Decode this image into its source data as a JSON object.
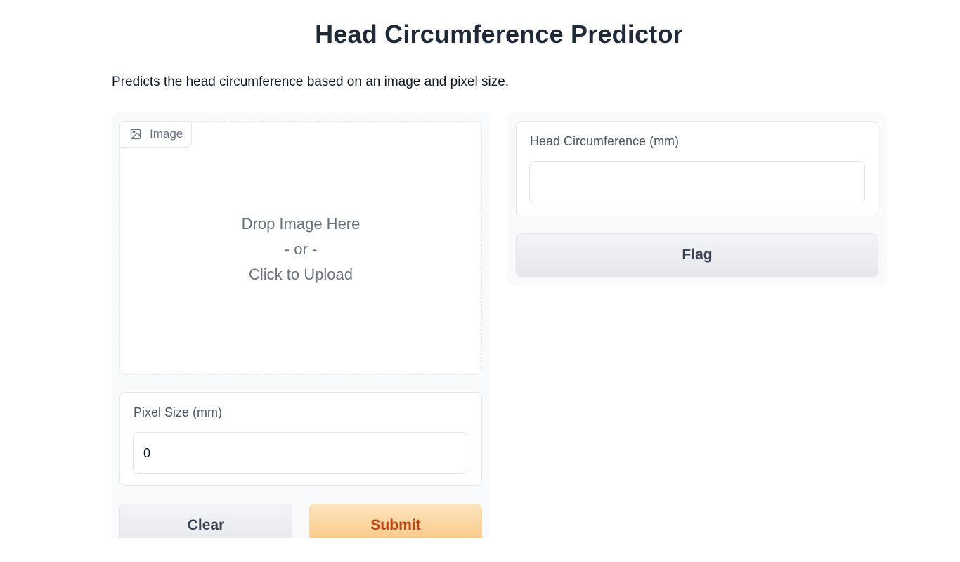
{
  "header": {
    "title": "Head Circumference Predictor",
    "description": "Predicts the head circumference based on an image and pixel size."
  },
  "inputs": {
    "image": {
      "label": "Image",
      "icon": "image-icon",
      "drop_text": "Drop Image Here",
      "or_text": "- or -",
      "click_text": "Click to Upload"
    },
    "pixel_size": {
      "label": "Pixel Size (mm)",
      "value": "0"
    }
  },
  "buttons": {
    "clear": "Clear",
    "submit": "Submit",
    "flag": "Flag"
  },
  "outputs": {
    "head_circumference": {
      "label": "Head Circumference (mm)",
      "value": ""
    }
  },
  "colors": {
    "submit_text": "#c2410c",
    "submit_bg": "#f7c57d",
    "panel_bg": "#f9fafb",
    "border": "#e5e7eb"
  }
}
